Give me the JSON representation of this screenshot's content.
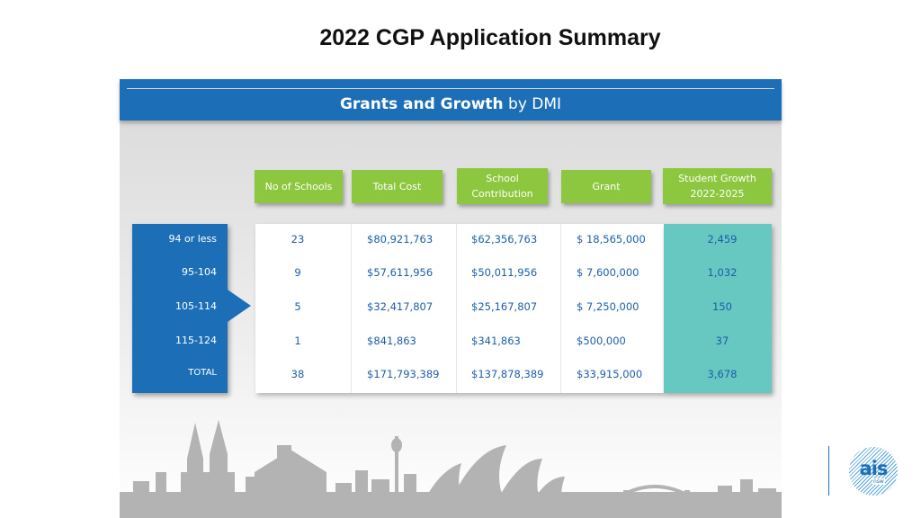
{
  "slide": {
    "title": "2022 CGP Application Summary"
  },
  "banner": {
    "title_bold": "Grants and Growth",
    "title_rest": "by DMI"
  },
  "table": {
    "headers": [
      {
        "line1": "No of Schools",
        "line2": ""
      },
      {
        "line1": "Total Cost",
        "line2": ""
      },
      {
        "line1": "School",
        "line2": "Contribution"
      },
      {
        "line1": "Grant",
        "line2": ""
      },
      {
        "line1": "Student Growth",
        "line2": "2022-2025"
      }
    ],
    "rows": [
      {
        "label": "94 or less",
        "schools": "23",
        "total_cost": "$80,921,763",
        "contribution": "$62,356,763",
        "grant": "$ 18,565,000",
        "growth": "2,459"
      },
      {
        "label": "95-104",
        "schools": "9",
        "total_cost": "$57,611,956",
        "contribution": "$50,011,956",
        "grant": "$ 7,600,000",
        "growth": "1,032"
      },
      {
        "label": "105-114",
        "schools": "5",
        "total_cost": "$32,417,807",
        "contribution": "$25,167,807",
        "grant": "$ 7,250,000",
        "growth": "150"
      },
      {
        "label": "115-124",
        "schools": "1",
        "total_cost": "$841,863",
        "contribution": "$341,863",
        "grant": "$500,000",
        "growth": "37"
      },
      {
        "label": "TOTAL",
        "schools": "38",
        "total_cost": "$171,793,389",
        "contribution": "$137,878,389",
        "grant": "$33,915,000",
        "growth": "3,678"
      }
    ]
  },
  "logo": {
    "text": "ais",
    "sub": "nsw"
  },
  "colors": {
    "blue": "#1c6fb7",
    "green": "#8dc63f",
    "teal": "#67c7c1",
    "text_blue": "#1c5ea8"
  }
}
